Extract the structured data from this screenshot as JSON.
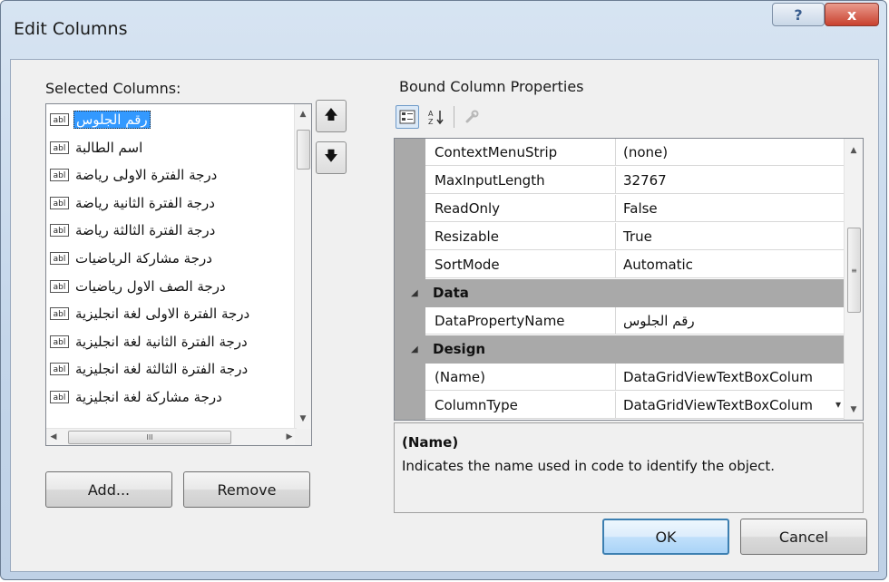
{
  "window": {
    "title": "Edit Columns",
    "help_glyph": "?",
    "close_glyph": "x"
  },
  "selected_columns": {
    "label": "Selected Columns:",
    "badge": "abl",
    "items": [
      "رقم الجلوس",
      "اسم الطالبة",
      "درجة الفترة الاولى رياضة",
      "درجة الفترة الثانية رياضة",
      "درجة الفترة الثالثة رياضة",
      "درجة مشاركة الرياضيات",
      "درجة الصف الاول رياضيات",
      "درجة الفترة الاولى لغة انجليزية",
      "درجة الفترة الثانية لغة انجليزية",
      "درجة الفترة الثالثة لغة انجليزية",
      "درجة مشاركة لغة انجليزية"
    ],
    "selected_index": 0
  },
  "move_buttons": {
    "up_glyph": "🡅",
    "down_glyph": "🡇"
  },
  "buttons": {
    "add": "Add...",
    "remove": "Remove",
    "ok": "OK",
    "cancel": "Cancel"
  },
  "properties": {
    "label": "Bound Column Properties",
    "toolbar_icons": [
      "categorized-icon",
      "alphabetical-icon",
      "property-pages-icon"
    ],
    "rows": [
      {
        "type": "prop",
        "name": "ContextMenuStrip",
        "value": "(none)"
      },
      {
        "type": "prop",
        "name": "MaxInputLength",
        "value": "32767"
      },
      {
        "type": "prop",
        "name": "ReadOnly",
        "value": "False"
      },
      {
        "type": "prop",
        "name": "Resizable",
        "value": "True"
      },
      {
        "type": "prop",
        "name": "SortMode",
        "value": "Automatic"
      },
      {
        "type": "cat",
        "name": "Data"
      },
      {
        "type": "prop",
        "name": "DataPropertyName",
        "value": "رقم الجلوس",
        "rtl": true
      },
      {
        "type": "cat",
        "name": "Design"
      },
      {
        "type": "prop",
        "name": "(Name)",
        "value": "DataGridViewTextBoxColum"
      },
      {
        "type": "prop",
        "name": "ColumnType",
        "value": "DataGridViewTextBoxColum"
      }
    ]
  },
  "description": {
    "title": "(Name)",
    "text": "Indicates the name used in code to identify the object."
  }
}
